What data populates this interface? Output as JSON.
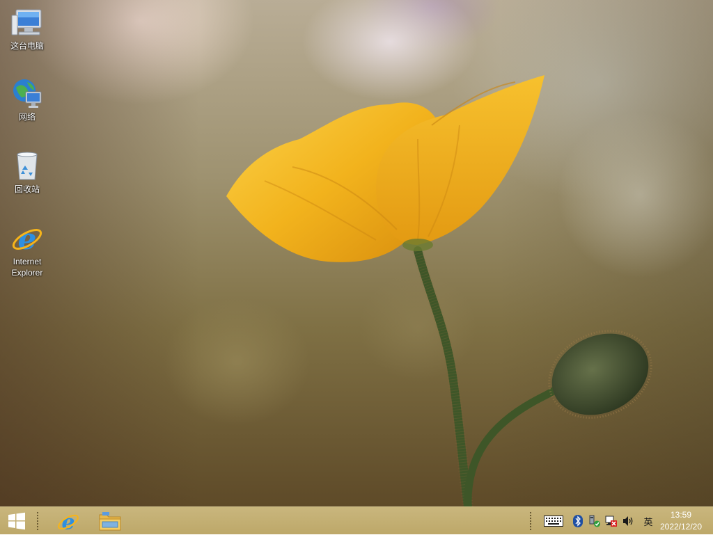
{
  "desktop": {
    "icons": [
      {
        "label": "这台电脑",
        "icon": "computer-icon"
      },
      {
        "label": "网络",
        "icon": "network-icon"
      },
      {
        "label": "回收站",
        "icon": "recycle-bin-icon"
      },
      {
        "label": "Internet\nExplorer",
        "icon": "internet-explorer-icon"
      }
    ]
  },
  "taskbar": {
    "start": {
      "icon": "windows-logo-icon"
    },
    "pinned": [
      {
        "icon": "internet-explorer-icon"
      },
      {
        "icon": "file-explorer-icon"
      }
    ],
    "tray": {
      "icons": [
        "touch-keyboard-icon",
        "bluetooth-icon",
        "safely-remove-hardware-icon",
        "network-disconnected-icon",
        "volume-icon"
      ],
      "language": "英"
    },
    "clock": {
      "time": "13:59",
      "date": "2022/12/20"
    }
  },
  "colors": {
    "taskbar": "#c4b072",
    "flower": "#f1b21c",
    "stem": "#3f5a2a"
  }
}
